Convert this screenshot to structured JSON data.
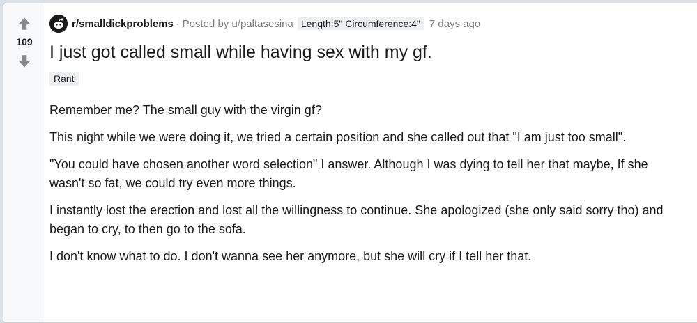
{
  "vote": {
    "count": "109"
  },
  "header": {
    "subreddit": "r/smalldickproblems",
    "separator": "·",
    "posted_by": "Posted by u/paltasesina",
    "user_flair": "Length:5\" Circumference:4\"",
    "timestamp": "7 days ago"
  },
  "post": {
    "title": "I just got called small while having sex with my gf.",
    "flair": "Rant",
    "paragraphs": [
      "Remember me? The small guy with the virgin gf?",
      "This night while we were doing it, we tried a certain position and she called out that \"I am just too small\".",
      "\"You could have chosen another word selection\" I answer. Although I was dying to tell her that maybe, If she wasn't so fat, we could try even more things.",
      "I instantly lost the erection and lost all the willingness to continue. She apologized (she only said sorry tho) and began to cry, to then go to the sofa.",
      "I don't know what to do. I don't wanna see her anymore, but she will cry if I tell her that."
    ]
  },
  "icons": {
    "upvote": "arrow-up-icon",
    "downvote": "arrow-down-icon",
    "subreddit": "subreddit-avatar-icon"
  },
  "colors": {
    "arrow": "#878a8c",
    "meta_text": "#7c7c7c",
    "text": "#1a1a1b",
    "flair_bg": "#edeff1"
  }
}
